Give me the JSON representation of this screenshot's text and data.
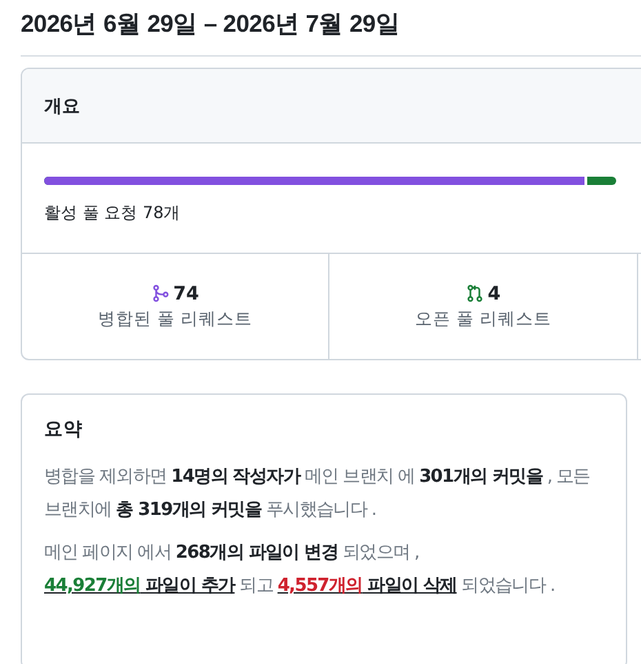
{
  "title": "2026년 6월 29일 – 2026년 7월 29일",
  "overview": {
    "heading": "개요",
    "bar": {
      "level": 0.95
    },
    "active_label": "활성 풀 요청 78개",
    "stats": [
      {
        "kind": "merged",
        "count": "74",
        "label": "병합된 풀 리퀘스트"
      },
      {
        "kind": "open",
        "count": "4",
        "label": "오픈 풀 리퀘스트"
      }
    ]
  },
  "summary": {
    "heading": "요약",
    "paragraphs": [
      [
        {
          "kind": "plain",
          "text": "병합을 제외하면"
        },
        {
          "kind": "bold",
          "text": "14명의 작성자가"
        },
        {
          "kind": "plain",
          "text": "메인 브랜치 에"
        },
        {
          "kind": "bold",
          "text": "301개의 커밋을"
        },
        {
          "kind": "plain",
          "text": ", 모든 브랜치에"
        },
        {
          "kind": "bold",
          "text": "총 319개의 커밋을"
        },
        {
          "kind": "plain",
          "text": "푸시했습니다 ."
        }
      ],
      [
        {
          "kind": "plain",
          "text": "메인 페이지 에서"
        },
        {
          "kind": "bold",
          "text": "268개의 파일이 변경"
        },
        {
          "kind": "plain",
          "text": "되었으며 ,"
        },
        {
          "kind": "added-link",
          "number": "44,927개의",
          "text": "파일이 추가"
        },
        {
          "kind": "plain",
          "text": "되고"
        },
        {
          "kind": "removed-link",
          "number": "4,557개의",
          "text": "파일이 삭제"
        },
        {
          "kind": "plain",
          "text": "되었습니다 ."
        }
      ]
    ]
  }
}
